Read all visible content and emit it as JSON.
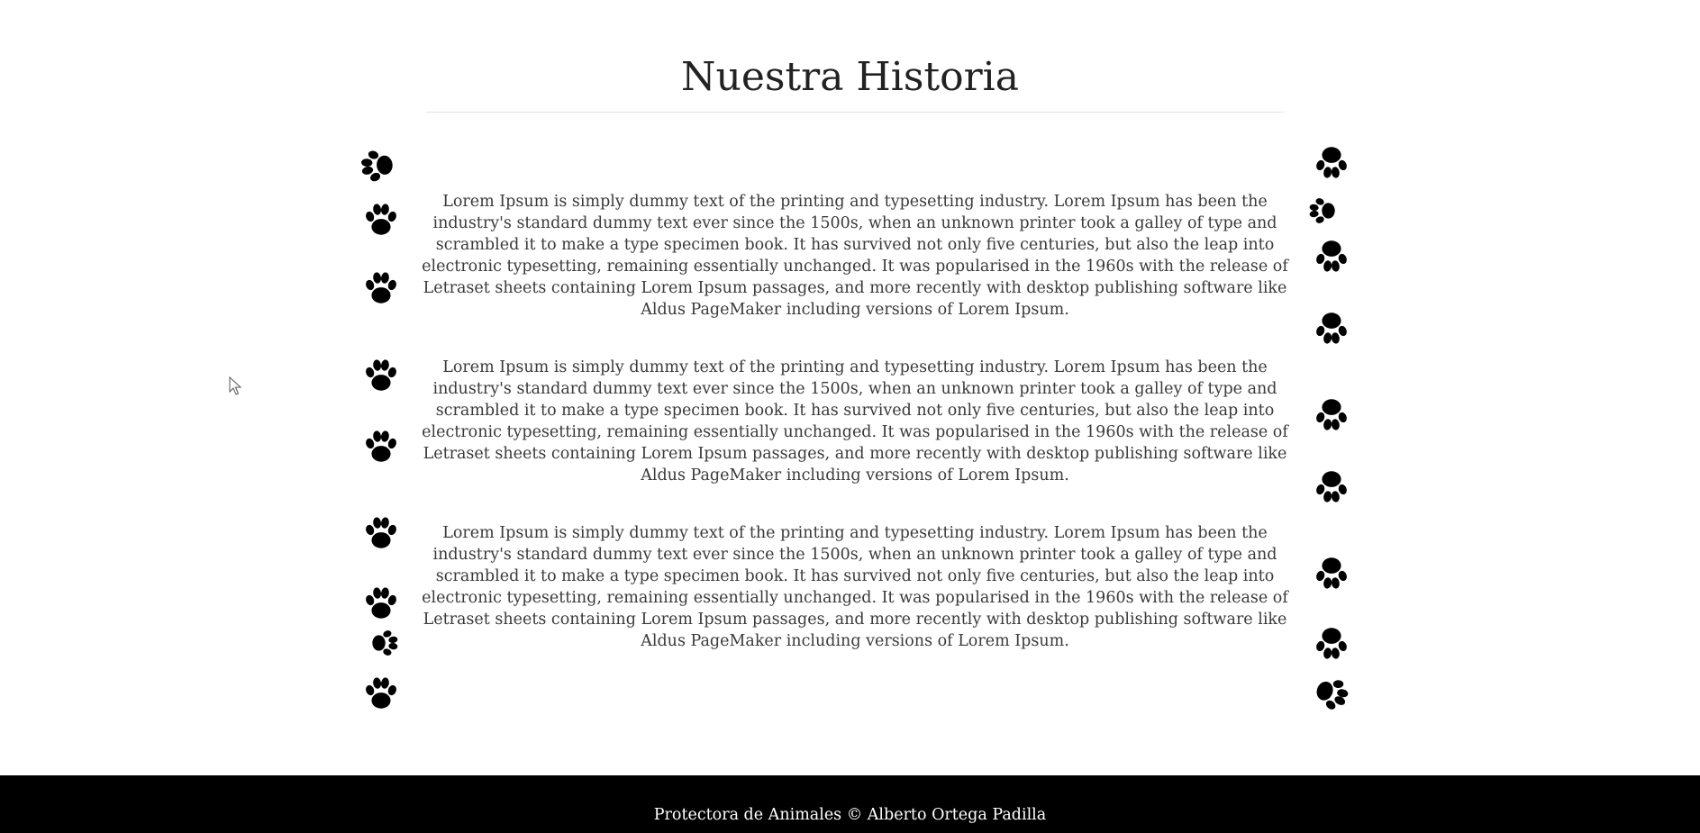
{
  "header": {
    "title": "Nuestra Historia"
  },
  "main": {
    "paragraphs": [
      "Lorem Ipsum is simply dummy text of the printing and typesetting industry. Lorem Ipsum has been the industry's standard dummy text ever since the 1500s, when an unknown printer took a galley of type and scrambled it to make a type specimen book. It has survived not only five centuries, but also the leap into electronic typesetting, remaining essentially unchanged. It was popularised in the 1960s with the release of Letraset sheets containing Lorem Ipsum passages, and more recently with desktop publishing software like Aldus PageMaker including versions of Lorem Ipsum.",
      "Lorem Ipsum is simply dummy text of the printing and typesetting industry. Lorem Ipsum has been the industry's standard dummy text ever since the 1500s, when an unknown printer took a galley of type and scrambled it to make a type specimen book. It has survived not only five centuries, but also the leap into electronic typesetting, remaining essentially unchanged. It was popularised in the 1960s with the release of Letraset sheets containing Lorem Ipsum passages, and more recently with desktop publishing software like Aldus PageMaker including versions of Lorem Ipsum.",
      "Lorem Ipsum is simply dummy text of the printing and typesetting industry. Lorem Ipsum has been the industry's standard dummy text ever since the 1500s, when an unknown printer took a galley of type and scrambled it to make a type specimen book. It has survived not only five centuries, but also the leap into electronic typesetting, remaining essentially unchanged. It was popularised in the 1960s with the release of Letraset sheets containing Lorem Ipsum passages, and more recently with desktop publishing software like Aldus PageMaker including versions of Lorem Ipsum."
    ]
  },
  "decorations": {
    "left_icon": "paw-print-icon",
    "right_icon": "paw-print-icon"
  },
  "footer": {
    "text": "Protectora de Animales © Alberto Ortega Padilla"
  },
  "colors": {
    "page_background": "#ffffff",
    "footer_background": "#000000",
    "footer_text": "#ffffff",
    "paw": "#000000"
  }
}
